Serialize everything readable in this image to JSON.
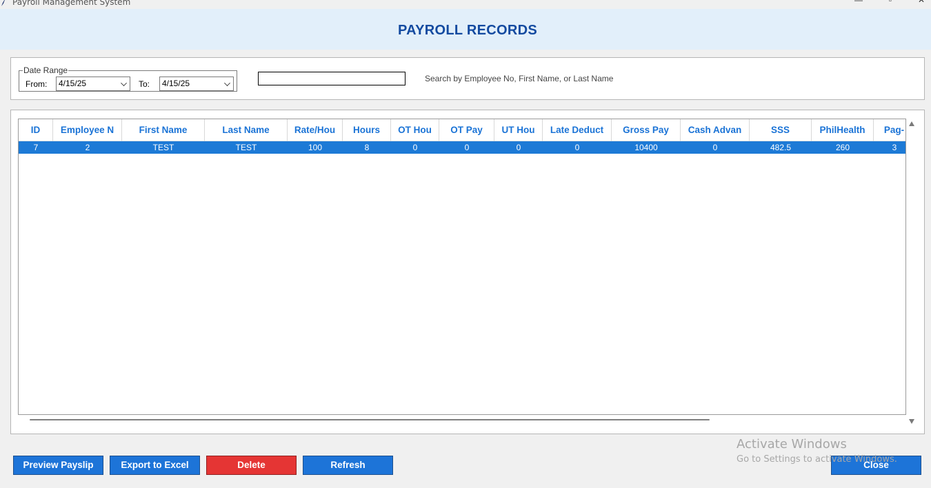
{
  "window": {
    "title": "Payroll Management System",
    "minimize": "—",
    "maximize": "▫",
    "close": "✕"
  },
  "header": {
    "title": "PAYROLL RECORDS"
  },
  "filters": {
    "date_range_legend": "Date Range",
    "from_label": "From:",
    "from_value": "4/15/25",
    "to_label": "To:",
    "to_value": "4/15/25",
    "search_value": "",
    "search_hint": "Search by Employee No, First Name, or Last Name"
  },
  "table": {
    "columns": [
      "ID",
      "Employee N",
      "First Name",
      "Last Name",
      "Rate/Hou",
      "Hours",
      "OT Hou",
      "OT Pay",
      "UT Hou",
      "Late Deduct",
      "Gross Pay",
      "Cash Advan",
      "SSS",
      "PhilHealth",
      "Pag-"
    ],
    "rows": [
      [
        "7",
        "2",
        "TEST",
        "TEST",
        "100",
        "8",
        "0",
        "0",
        "0",
        "0",
        "10400",
        "0",
        "482.5",
        "260",
        "3"
      ]
    ]
  },
  "buttons": {
    "preview": "Preview Payslip",
    "export": "Export to Excel",
    "delete": "Delete",
    "refresh": "Refresh",
    "close": "Close"
  },
  "watermark": {
    "title": "Activate Windows",
    "subtitle": "Go to Settings to activate Windows."
  },
  "colors": {
    "accent_blue": "#1d74d8",
    "header_title": "#134aa0",
    "header_bg": "#e2effa",
    "delete_red": "#e53534",
    "selected_row": "#1d7ad6",
    "column_header_text": "#1a73d6"
  }
}
